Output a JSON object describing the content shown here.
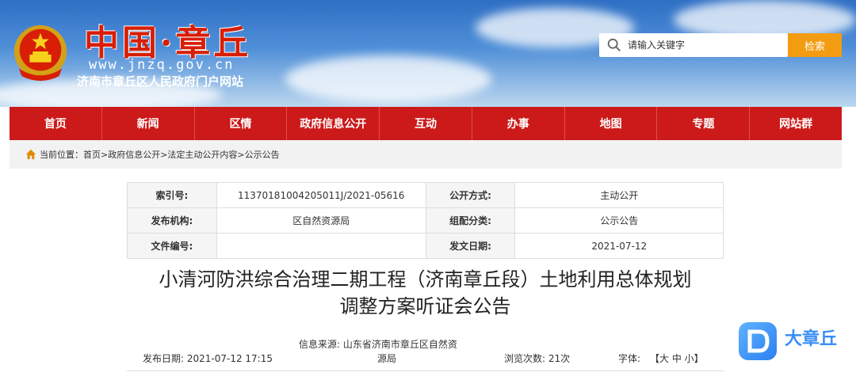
{
  "header": {
    "brand_title": "中国·章丘",
    "domain": "www.jnzq.gov.cn",
    "subtitle": "济南市章丘区人民政府门户网站"
  },
  "search": {
    "placeholder": "请输入关键字",
    "button_label": "检索"
  },
  "nav": {
    "items": [
      "首页",
      "新闻",
      "区情",
      "政府信息公开",
      "互动",
      "办事",
      "地图",
      "专题",
      "网站群"
    ]
  },
  "breadcrumb": {
    "label": "当前位置：",
    "path": "首页>政府信息公开>法定主动公开内容>公示公告"
  },
  "info": {
    "index_label": "索引号:",
    "index_value": "11370181004205011J/2021-05616",
    "disclosure_label": "公开方式:",
    "disclosure_value": "主动公开",
    "publisher_label": "发布机构:",
    "publisher_value": "区自然资源局",
    "category_label": "组配分类:",
    "category_value": "公示公告",
    "docno_label": "文件编号:",
    "docno_value": "",
    "date_label": "发文日期:",
    "date_value": "2021-07-12"
  },
  "article": {
    "title_line1": "小清河防洪综合治理二期工程（济南章丘段）土地利用总体规划",
    "title_line2": "调整方案听证会公告",
    "publish_date": "发布日期:  2021-07-12 17:15",
    "source_line1": "信息来源:  山东省济南市章丘区自然资",
    "source_line2": "源局",
    "views": "浏览次数:  21次",
    "font_label": "字体:",
    "font_sizes": "【大 中 小】"
  },
  "watermark": {
    "text": "大章丘"
  },
  "colors": {
    "nav_red": "#cc1a1a",
    "search_orange": "#f39c12",
    "brand_red": "#d81e06"
  }
}
